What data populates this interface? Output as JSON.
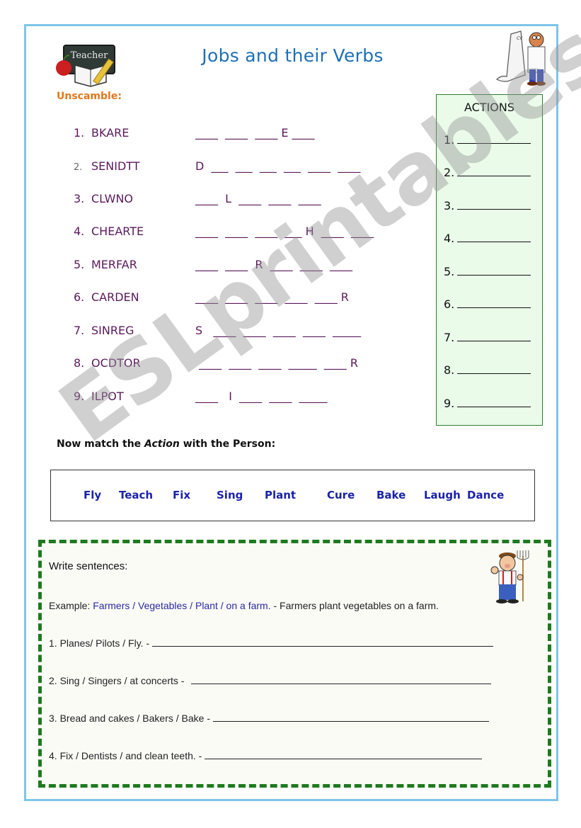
{
  "header": {
    "title": "Jobs and their Verbs",
    "teacher_sign": "Teacher",
    "unscramble_label": "Unscamble:"
  },
  "unscramble": {
    "items": [
      {
        "number": "1.",
        "word": "BKARE",
        "pattern": "____  ____  ____ E ____"
      },
      {
        "number": "2.",
        "word": "SENIDTT",
        "pattern": "D  ___  ___  ___  ___  ____  ____"
      },
      {
        "number": "3.",
        "word": "CLWNO",
        "pattern": "____  L  ____  ____  ____"
      },
      {
        "number": "4.",
        "word": "CHEARTE",
        "pattern": "____  ____  ____  ___ H  ____  ____"
      },
      {
        "number": "5.",
        "word": "MERFAR",
        "pattern": "____  ____  R  ____  ____  ____"
      },
      {
        "number": "6.",
        "word": "CARDEN",
        "pattern": "____  ____  ____  ____  ____ R"
      },
      {
        "number": "7.",
        "word": "SINREG",
        "pattern": "S   ____  ____  ____  ____  _____"
      },
      {
        "number": "8.",
        "word": "OCDTOR",
        "pattern": " ____  ____  ____  _____  ____ R"
      },
      {
        "number": "9.",
        "word": "ILPOT",
        "pattern": "____   I  ____  ____  _____"
      }
    ]
  },
  "actions": {
    "title": "ACTIONS",
    "lines": [
      "1.",
      "2.",
      "3.",
      "4.",
      "5.",
      "6.",
      "7.",
      "8.",
      "9."
    ]
  },
  "match": {
    "label_prefix": "Now match the ",
    "label_italic": "Action",
    "label_suffix": " with the Person:",
    "verbs": [
      "Fly",
      "Teach",
      "Fix",
      "Sing",
      "Plant",
      "Cure",
      "Bake",
      "Laugh",
      "Dance"
    ]
  },
  "sentences": {
    "label": "Write sentences:",
    "example_prefix": "Example:  ",
    "example_prompt": "Farmers / Vegetables / Plant / on a farm.",
    "example_answer": " -  Farmers  plant vegetables on a farm.",
    "items": [
      "1. Planes/ Pilots / Fly. -",
      "2. Sing / Singers / at concerts -",
      "3. Bread and cakes / Bakers / Bake -",
      "4.  Fix / Dentists / and clean teeth. -"
    ]
  },
  "watermark": "ESLprintables.com",
  "colors": {
    "title": "#1f6fb5",
    "unscramble_text": "#5a1a5a",
    "verbs": "#1c23a8",
    "page_border": "#7ec5e8",
    "dashed_border": "#1e7a1e",
    "actions_bg": "#eafbea"
  }
}
